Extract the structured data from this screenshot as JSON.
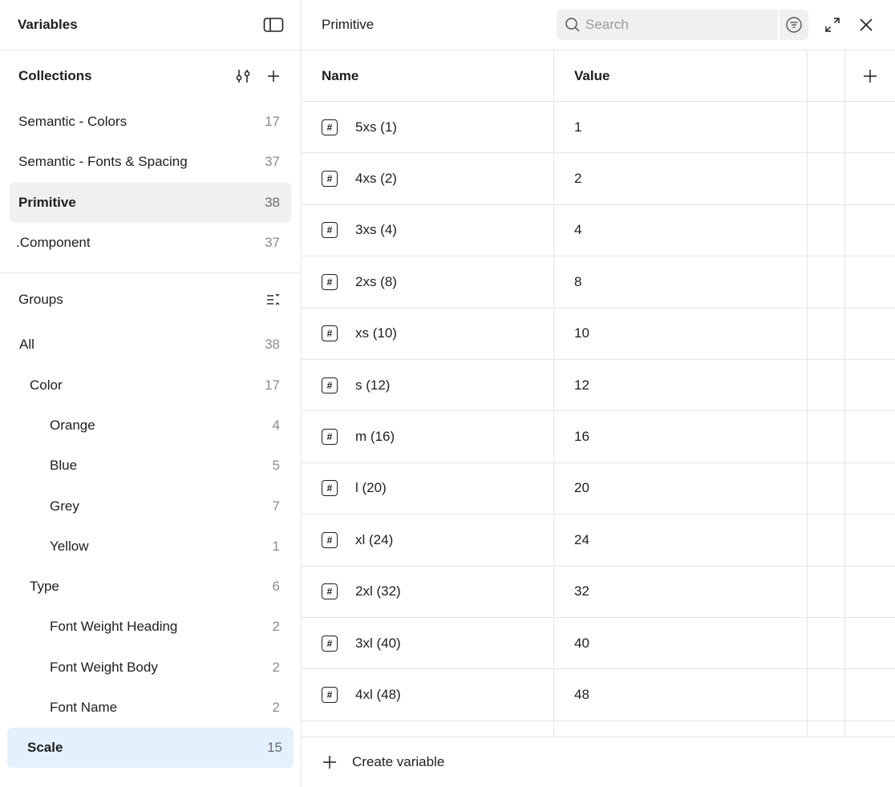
{
  "sidebar": {
    "title": "Variables",
    "collections": {
      "title": "Collections",
      "items": [
        {
          "label": "Semantic - Colors",
          "count": "17"
        },
        {
          "label": "Semantic - Fonts & Spacing",
          "count": "37"
        },
        {
          "label": "Primitive",
          "count": "38"
        },
        {
          "label": ".Component",
          "count": "37"
        }
      ]
    },
    "groups": {
      "title": "Groups",
      "items": [
        {
          "label": "All",
          "count": "38"
        },
        {
          "label": "Color",
          "count": "17"
        },
        {
          "label": "Orange",
          "count": "4"
        },
        {
          "label": "Blue",
          "count": "5"
        },
        {
          "label": "Grey",
          "count": "7"
        },
        {
          "label": "Yellow",
          "count": "1"
        },
        {
          "label": "Type",
          "count": "6"
        },
        {
          "label": "Font Weight Heading",
          "count": "2"
        },
        {
          "label": "Font Weight Body",
          "count": "2"
        },
        {
          "label": "Font Name",
          "count": "2"
        },
        {
          "label": "Scale",
          "count": "15"
        }
      ]
    }
  },
  "main": {
    "title": "Primitive",
    "search": {
      "placeholder": "Search",
      "value": ""
    },
    "table": {
      "columns": {
        "name": "Name",
        "value": "Value"
      },
      "rows": [
        {
          "name": "5xs (1)",
          "value": "1",
          "icon": "number-icon"
        },
        {
          "name": "4xs (2)",
          "value": "2",
          "icon": "number-icon"
        },
        {
          "name": "3xs (4)",
          "value": "4",
          "icon": "number-icon"
        },
        {
          "name": "2xs (8)",
          "value": "8",
          "icon": "number-icon"
        },
        {
          "name": "xs (10)",
          "value": "10",
          "icon": "number-icon"
        },
        {
          "name": "s (12)",
          "value": "12",
          "icon": "number-icon"
        },
        {
          "name": "m (16)",
          "value": "16",
          "icon": "number-icon"
        },
        {
          "name": "l (20)",
          "value": "20",
          "icon": "number-icon"
        },
        {
          "name": "xl (24)",
          "value": "24",
          "icon": "number-icon"
        },
        {
          "name": "2xl (32)",
          "value": "32",
          "icon": "number-icon"
        },
        {
          "name": "3xl (40)",
          "value": "40",
          "icon": "number-icon"
        },
        {
          "name": "4xl (48)",
          "value": "48",
          "icon": "number-icon"
        }
      ]
    },
    "footer": {
      "create_label": "Create variable"
    },
    "number_icon_glyph": "#"
  },
  "colors": {
    "selected_blue": "#e3f1fd",
    "selected_grey": "#f0f0f0",
    "divider": "#e6e6e6",
    "muted_text": "#8c8c8c"
  }
}
